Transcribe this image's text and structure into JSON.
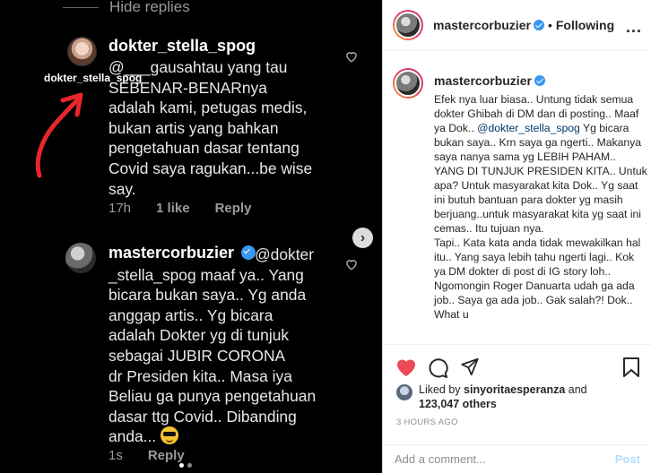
{
  "media": {
    "hide_replies": "Hide replies",
    "overlay_tag": "dokter_stella_spog",
    "comment1": {
      "username": "dokter_stella_spog",
      "text": "@___gausahtau yang tau\nSEBENAR-BENARnya\nadalah kami, petugas medis,\nbukan artis yang bahkan\npengetahuan dasar tentang\nCovid saya ragukan...be wise\nsay.",
      "time": "17h",
      "likes": "1 like",
      "reply": "Reply"
    },
    "comment2": {
      "username": "mastercorbuzier",
      "text": "@dokter\n_stella_spog maaf ya..  Yang\nbicara bukan saya.. Yg anda\nanggap artis.. Yg bicara\nadalah Dokter yg di tunjuk\nsebagai JUBIR CORONA\ndr Presiden kita.. Masa iya\nBeliau ga punya pengetahuan\ndasar ttg Covid.. Dibanding\nanda...",
      "time": "1s",
      "reply": "Reply"
    },
    "colors": {
      "arrow": "#e8262b"
    }
  },
  "sidebar": {
    "header": {
      "username": "mastercorbuzier",
      "separator": "•",
      "following": "Following",
      "more": "..."
    },
    "caption": {
      "username": "mastercorbuzier",
      "p1_start": "Efek nya luar biasa.. Untung tidak semua dokter Ghibah di DM dan di posting.. Maaf ya Dok..",
      "mention": "@dokter_stella_spog",
      "p1_rest": " Yg bicara bukan saya.. Krn saya ga ngerti.. Makanya saya nanya sama yg LEBIH PAHAM.. YANG DI TUNJUK PRESIDEN KITA.. Untuk apa? Untuk masyarakat kita Dok.. Yg saat ini butuh bantuan para dokter yg masih berjuang..untuk masyarakat kita yg saat ini cemas.. Itu tujuan nya.",
      "p2": "Tapi.. Kata kata anda tidak mewakilkan hal itu.. Yang saya lebih tahu ngerti lagi.. Kok ya DM dokter di post di IG story loh.. Ngomongin Roger Danuarta udah ga ada job.. Saya ga ada job.. Gak salah?! Dok.. What u"
    },
    "likes": {
      "prefix": "Liked by",
      "user": "sinyoritaesperanza",
      "and": "and",
      "count": "123,047 others"
    },
    "time_ago": "3 HOURS AGO",
    "comment_placeholder": "Add a comment...",
    "post_label": "Post",
    "colors": {
      "heart": "#ed4956",
      "link": "#00376b",
      "verified": "#3897f0"
    }
  }
}
